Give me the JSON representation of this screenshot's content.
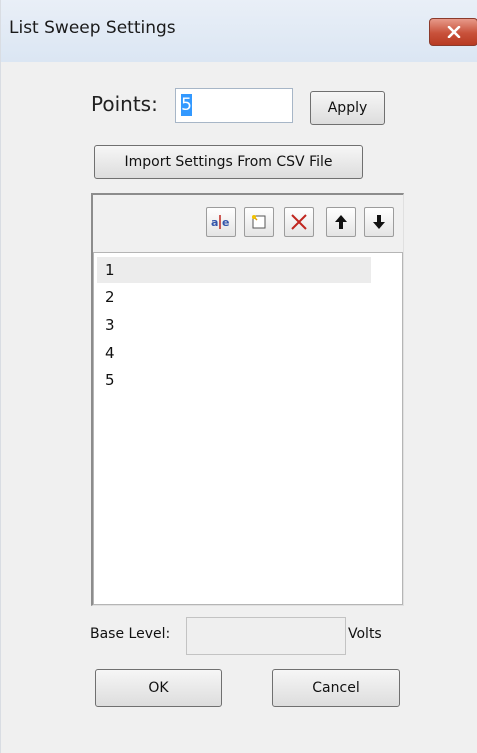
{
  "window": {
    "title": "List Sweep Settings"
  },
  "points": {
    "label": "Points:",
    "value": "5",
    "apply_label": "Apply"
  },
  "import_label": "Import Settings From CSV File",
  "toolbar": {
    "items": [
      {
        "icon": "edit-text-icon"
      },
      {
        "icon": "new-item-icon"
      },
      {
        "icon": "delete-icon",
        "color": "#c0261f"
      },
      {
        "icon": "move-up-icon"
      },
      {
        "icon": "move-down-icon"
      }
    ]
  },
  "list": {
    "items": [
      "1",
      "2",
      "3",
      "4",
      "5"
    ],
    "selected_index": 0
  },
  "base_level": {
    "label": "Base Level:",
    "value": "",
    "unit": "Volts"
  },
  "buttons": {
    "ok_label": "OK",
    "cancel_label": "Cancel"
  },
  "colors": {
    "close_button": "#c8513a",
    "selection": "#3399ff",
    "title_bar": "#dbe6f3"
  }
}
